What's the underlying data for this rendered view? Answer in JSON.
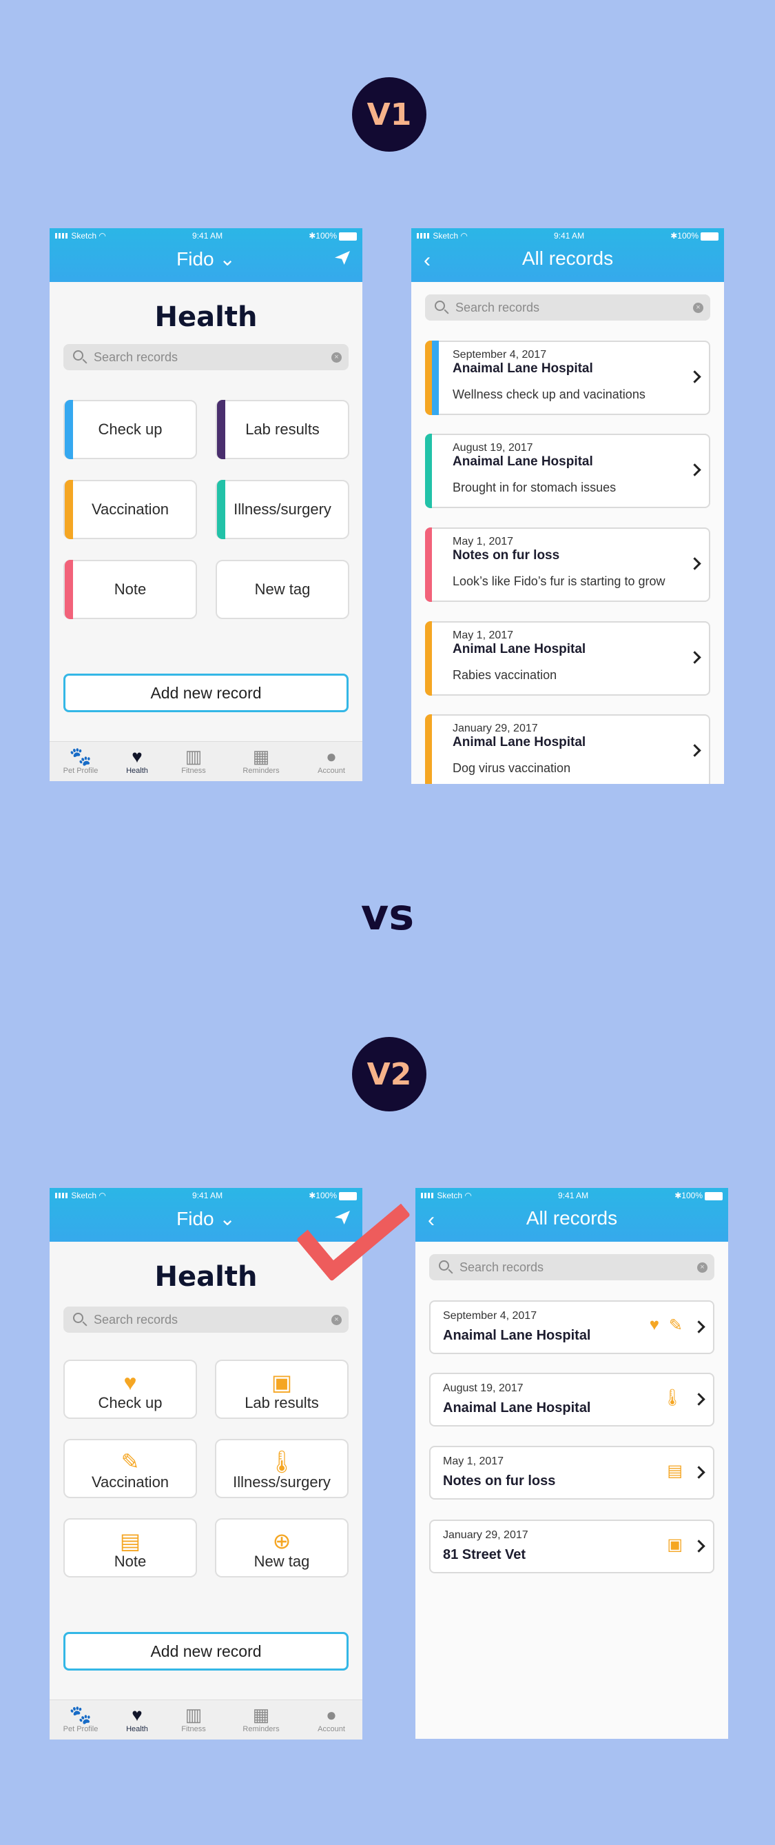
{
  "labels": {
    "v1": "V1",
    "vs": "vs",
    "v2": "V2"
  },
  "status": {
    "carrier": "Sketch",
    "time": "9:41 AM",
    "battery": "100%"
  },
  "health": {
    "header_title": "Fido ⌄",
    "page_title": "Health",
    "search_placeholder": "Search records",
    "tags": [
      "Check up",
      "Lab results",
      "Vaccination",
      "Illness/surgery",
      "Note",
      "New tag"
    ],
    "tag_colors": [
      "#35a8f0",
      "#4a2f6e",
      "#f5a623",
      "#22c2a8",
      "#f2627a"
    ],
    "tag_icons": [
      "heart-icon",
      "clipboard-icon",
      "syringe-icon",
      "thermometer-icon",
      "note-icon",
      "plus-circle-icon"
    ],
    "add_button": "Add new record",
    "tabs": [
      {
        "label": "Pet Profile",
        "icon": "paw-icon"
      },
      {
        "label": "Health",
        "icon": "heart-pulse-icon"
      },
      {
        "label": "Fitness",
        "icon": "bar-chart-icon"
      },
      {
        "label": "Reminders",
        "icon": "calendar-icon"
      },
      {
        "label": "Account",
        "icon": "person-icon"
      }
    ]
  },
  "records_v1": {
    "header_title": "All records",
    "search_placeholder": "Search records",
    "items": [
      {
        "date": "September  4, 2017",
        "title": "Anaimal Lane Hospital",
        "subtitle": "Wellness check up and vacinations",
        "colors": [
          "#f5a623",
          "#35a8f0"
        ]
      },
      {
        "date": "August  19, 2017",
        "title": "Anaimal Lane Hospital",
        "subtitle": "Brought in for stomach issues",
        "colors": [
          "#22c2a8"
        ]
      },
      {
        "date": "May 1, 2017",
        "title": "Notes on fur loss",
        "subtitle": "Look’s like Fido’s fur is starting to grow",
        "colors": [
          "#f2627a"
        ]
      },
      {
        "date": "May 1, 2017",
        "title": "Animal Lane Hospital",
        "subtitle": "Rabies vaccination",
        "colors": [
          "#f5a623"
        ]
      },
      {
        "date": "January 29, 2017",
        "title": "Animal Lane Hospital",
        "subtitle": "Dog virus vaccination",
        "colors": [
          "#f5a623"
        ]
      }
    ]
  },
  "records_v2": {
    "header_title": "All records",
    "search_placeholder": "Search records",
    "items": [
      {
        "date": "September  4, 2017",
        "title": "Anaimal Lane Hospital",
        "icons": [
          "heart-icon",
          "syringe-icon"
        ]
      },
      {
        "date": "August  19, 2017",
        "title": "Anaimal Lane Hospital",
        "icons": [
          "thermometer-icon"
        ]
      },
      {
        "date": "May 1, 2017",
        "title": "Notes on fur loss",
        "icons": [
          "note-icon"
        ]
      },
      {
        "date": "January 29, 2017",
        "title": "81 Street Vet",
        "icons": [
          "clipboard-icon"
        ]
      }
    ]
  },
  "accent": "#34b7e6",
  "check_color": "#ee5c5c"
}
